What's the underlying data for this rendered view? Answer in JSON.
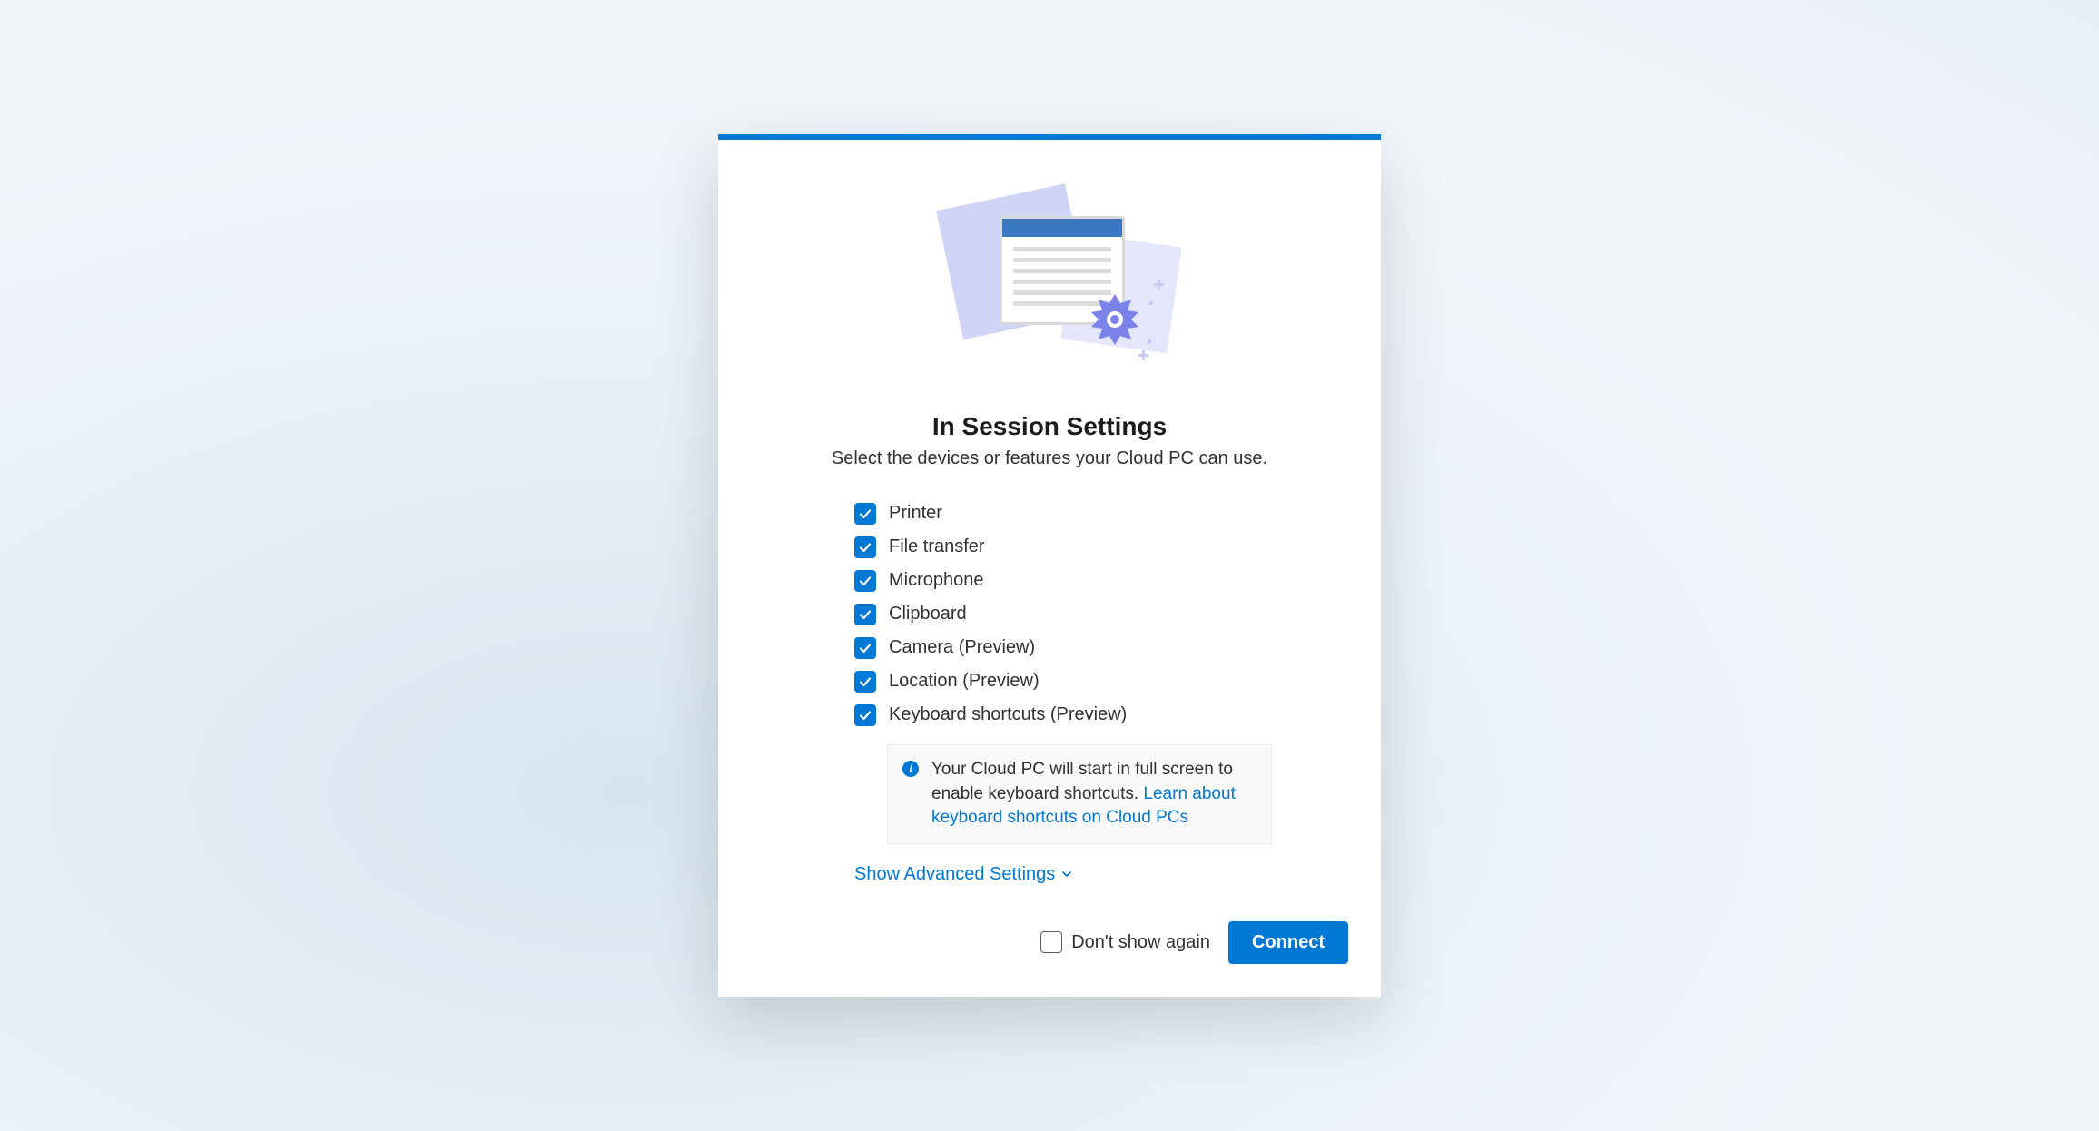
{
  "dialog": {
    "title": "In Session Settings",
    "subtitle": "Select the devices or features your Cloud PC can use.",
    "options": [
      {
        "label": "Printer",
        "checked": true
      },
      {
        "label": "File transfer",
        "checked": true
      },
      {
        "label": "Microphone",
        "checked": true
      },
      {
        "label": "Clipboard",
        "checked": true
      },
      {
        "label": "Camera (Preview)",
        "checked": true
      },
      {
        "label": "Location (Preview)",
        "checked": true
      },
      {
        "label": "Keyboard shortcuts (Preview)",
        "checked": true
      }
    ],
    "info": {
      "text": "Your Cloud PC will start in full screen to enable keyboard shortcuts. ",
      "link_text": "Learn about keyboard shortcuts on Cloud PCs"
    },
    "advanced_link": "Show Advanced Settings",
    "dont_show_label": "Don't show again",
    "dont_show_checked": false,
    "connect_label": "Connect"
  },
  "colors": {
    "primary": "#0078d4",
    "accent_purple": "#7b83eb"
  }
}
